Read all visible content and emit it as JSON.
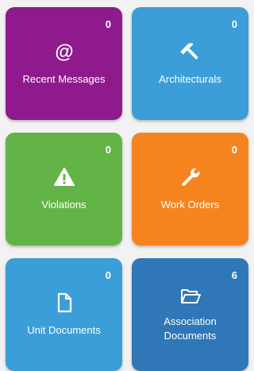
{
  "tiles": [
    {
      "id": "recent_messages",
      "label": "Recent Messages",
      "count": "0",
      "icon": "at-sign-icon",
      "color": "#8e1a8e"
    },
    {
      "id": "architecturals",
      "label": "Architecturals",
      "count": "0",
      "icon": "hammer-icon",
      "color": "#3b9ed8"
    },
    {
      "id": "violations",
      "label": "Violations",
      "count": "0",
      "icon": "warning-icon",
      "color": "#63b446"
    },
    {
      "id": "work_orders",
      "label": "Work Orders",
      "count": "0",
      "icon": "wrench-icon",
      "color": "#f5841f"
    },
    {
      "id": "unit_documents",
      "label": "Unit Documents",
      "count": "0",
      "icon": "document-icon",
      "color": "#3b9ed8"
    },
    {
      "id": "association_documents",
      "label_line1": "Association",
      "label_line2": "Documents",
      "count": "6",
      "icon": "folder-open-icon",
      "color": "#2f77b6"
    }
  ]
}
